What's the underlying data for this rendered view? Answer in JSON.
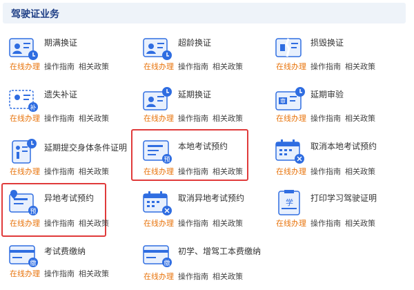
{
  "section": {
    "title": "驾驶证业务"
  },
  "colors": {
    "accent": "#e8740c",
    "icon_blue": "#2f6de1",
    "highlight": "#e03a3a"
  },
  "items": [
    {
      "title": "期满换证",
      "icon": "id-card-person-icon",
      "online": "在线办理",
      "guide": "操作指南",
      "policy": "相关政策"
    },
    {
      "title": "超龄换证",
      "icon": "id-card-age-icon",
      "online": "在线办理",
      "guide": "操作指南",
      "policy": "相关政策"
    },
    {
      "title": "损毁换证",
      "icon": "damaged-card-icon",
      "online": "在线办理",
      "guide": "操作指南",
      "policy": "相关政策"
    },
    {
      "title": "遗失补证",
      "icon": "lost-card-icon",
      "badge": "补",
      "online": "在线办理",
      "guide": "操作指南",
      "policy": "相关政策"
    },
    {
      "title": "延期换证",
      "icon": "extend-card-icon",
      "online": "在线办理",
      "guide": "操作指南",
      "policy": "相关政策"
    },
    {
      "title": "延期审验",
      "icon": "extend-review-icon",
      "badge": "审",
      "online": "在线办理",
      "guide": "操作指南",
      "policy": "相关政策"
    },
    {
      "title": "延期提交身体条件证明",
      "icon": "health-proof-icon",
      "online": "在线办理",
      "guide": "操作指南",
      "policy": "相关政策"
    },
    {
      "title": "本地考试预约",
      "icon": "local-exam-icon",
      "badge": "预",
      "online": "在线办理",
      "guide": "操作指南",
      "policy": "相关政策"
    },
    {
      "title": "取消本地考试预约",
      "icon": "cancel-calendar-icon",
      "online": "在线办理",
      "guide": "操作指南",
      "policy": "相关政策"
    },
    {
      "title": "异地考试预约",
      "icon": "remote-exam-icon",
      "badge": "预",
      "online": "在线办理",
      "guide": "操作指南",
      "policy": "相关政策"
    },
    {
      "title": "取消异地考试预约",
      "icon": "cancel-calendar-icon",
      "online": "在线办理",
      "guide": "操作指南",
      "policy": "相关政策"
    },
    {
      "title": "打印学习驾驶证明",
      "icon": "print-learner-icon",
      "badge": "学",
      "online": "在线办理",
      "guide": "操作指南",
      "policy": "相关政策"
    },
    {
      "title": "考试费缴纳",
      "icon": "exam-fee-icon",
      "badge": "缴",
      "online": "在线办理",
      "guide": "操作指南",
      "policy": "相关政策"
    },
    {
      "title": "初学、增驾工本费缴纳",
      "icon": "fee-payment-icon",
      "badge": "缴",
      "online": "在线办理",
      "guide": "操作指南",
      "policy": "相关政策"
    }
  ]
}
